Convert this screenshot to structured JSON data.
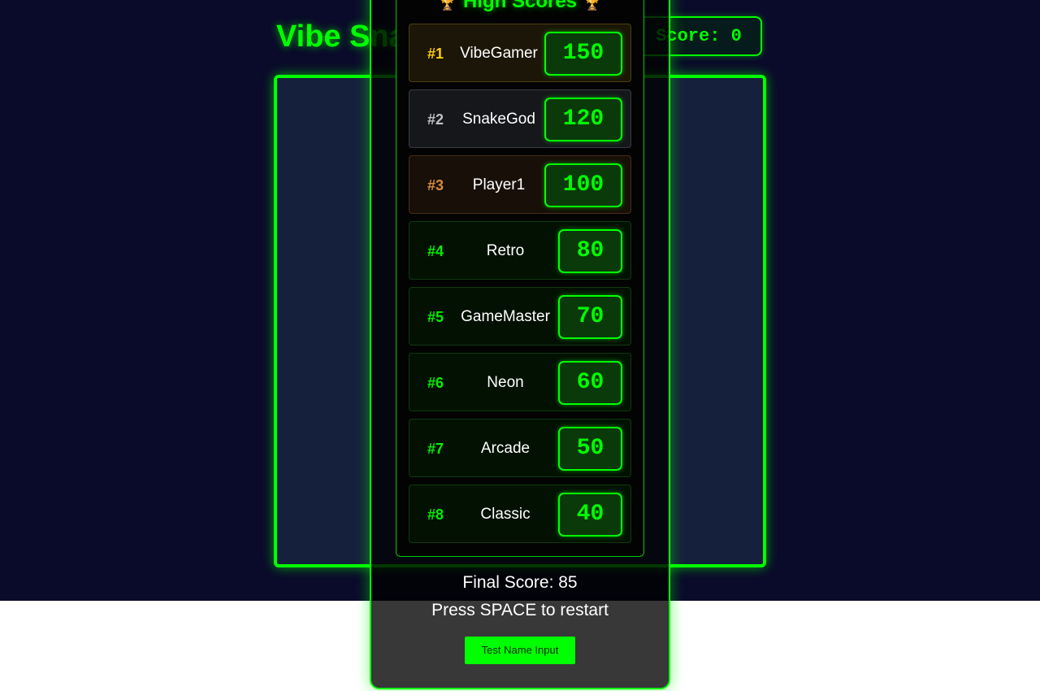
{
  "game": {
    "title": "Vibe Snake",
    "score_text": "Score: 0"
  },
  "high_scores": {
    "title": "High Scores",
    "trophy_icon": "🏆",
    "entries": [
      {
        "rank": "#1",
        "name": "VibeGamer",
        "score": "150"
      },
      {
        "rank": "#2",
        "name": "SnakeGod",
        "score": "120"
      },
      {
        "rank": "#3",
        "name": "Player1",
        "score": "100"
      },
      {
        "rank": "#4",
        "name": "Retro",
        "score": "80"
      },
      {
        "rank": "#5",
        "name": "GameMaster",
        "score": "70"
      },
      {
        "rank": "#6",
        "name": "Neon",
        "score": "60"
      },
      {
        "rank": "#7",
        "name": "Arcade",
        "score": "50"
      },
      {
        "rank": "#8",
        "name": "Classic",
        "score": "40"
      }
    ]
  },
  "game_over": {
    "final_score": "Final Score: 85",
    "restart_hint": "Press SPACE to restart",
    "test_button_label": "Test Name Input"
  },
  "colors": {
    "accent": "#00ff00",
    "background": "#0a0a2a",
    "board": "#15203c",
    "gold": "#ffcc00",
    "silver": "#c0c0c0",
    "bronze": "#d88a3a"
  }
}
